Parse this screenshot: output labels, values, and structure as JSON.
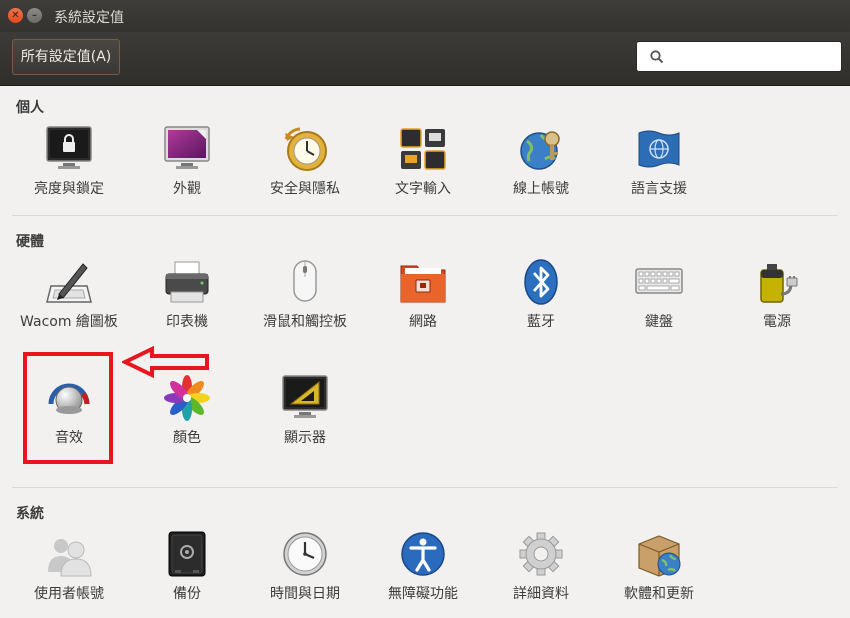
{
  "window": {
    "title": "系統設定值"
  },
  "toolbar": {
    "all_settings_label": "所有設定值(A)",
    "search_placeholder": "",
    "search_value": ""
  },
  "sections": {
    "personal": {
      "title": "個人",
      "items": [
        {
          "label": "亮度與鎖定",
          "icon": "brightness-lock-icon"
        },
        {
          "label": "外觀",
          "icon": "appearance-icon"
        },
        {
          "label": "安全與隱私",
          "icon": "security-privacy-icon"
        },
        {
          "label": "文字輸入",
          "icon": "text-entry-icon"
        },
        {
          "label": "線上帳號",
          "icon": "online-accounts-icon"
        },
        {
          "label": "語言支援",
          "icon": "language-support-icon"
        }
      ]
    },
    "hardware": {
      "title": "硬體",
      "items": [
        {
          "label": "Wacom 繪圖板",
          "icon": "wacom-tablet-icon"
        },
        {
          "label": "印表機",
          "icon": "printer-icon"
        },
        {
          "label": "滑鼠和觸控板",
          "icon": "mouse-icon"
        },
        {
          "label": "網路",
          "icon": "network-icon"
        },
        {
          "label": "藍牙",
          "icon": "bluetooth-icon"
        },
        {
          "label": "鍵盤",
          "icon": "keyboard-icon"
        },
        {
          "label": "電源",
          "icon": "power-icon"
        },
        {
          "label": "音效",
          "icon": "sound-icon"
        },
        {
          "label": "顏色",
          "icon": "color-icon"
        },
        {
          "label": "顯示器",
          "icon": "displays-icon"
        }
      ]
    },
    "system": {
      "title": "系統",
      "items": [
        {
          "label": "使用者帳號",
          "icon": "user-accounts-icon"
        },
        {
          "label": "備份",
          "icon": "backup-icon"
        },
        {
          "label": "時間與日期",
          "icon": "time-date-icon"
        },
        {
          "label": "無障礙功能",
          "icon": "accessibility-icon"
        },
        {
          "label": "詳細資料",
          "icon": "details-icon"
        },
        {
          "label": "軟體和更新",
          "icon": "software-updates-icon"
        }
      ]
    }
  },
  "colors": {
    "annotation": "#e8141e",
    "titlebar": "#3c3b37",
    "background": "#f2f1f0",
    "accent": "#e95420"
  }
}
